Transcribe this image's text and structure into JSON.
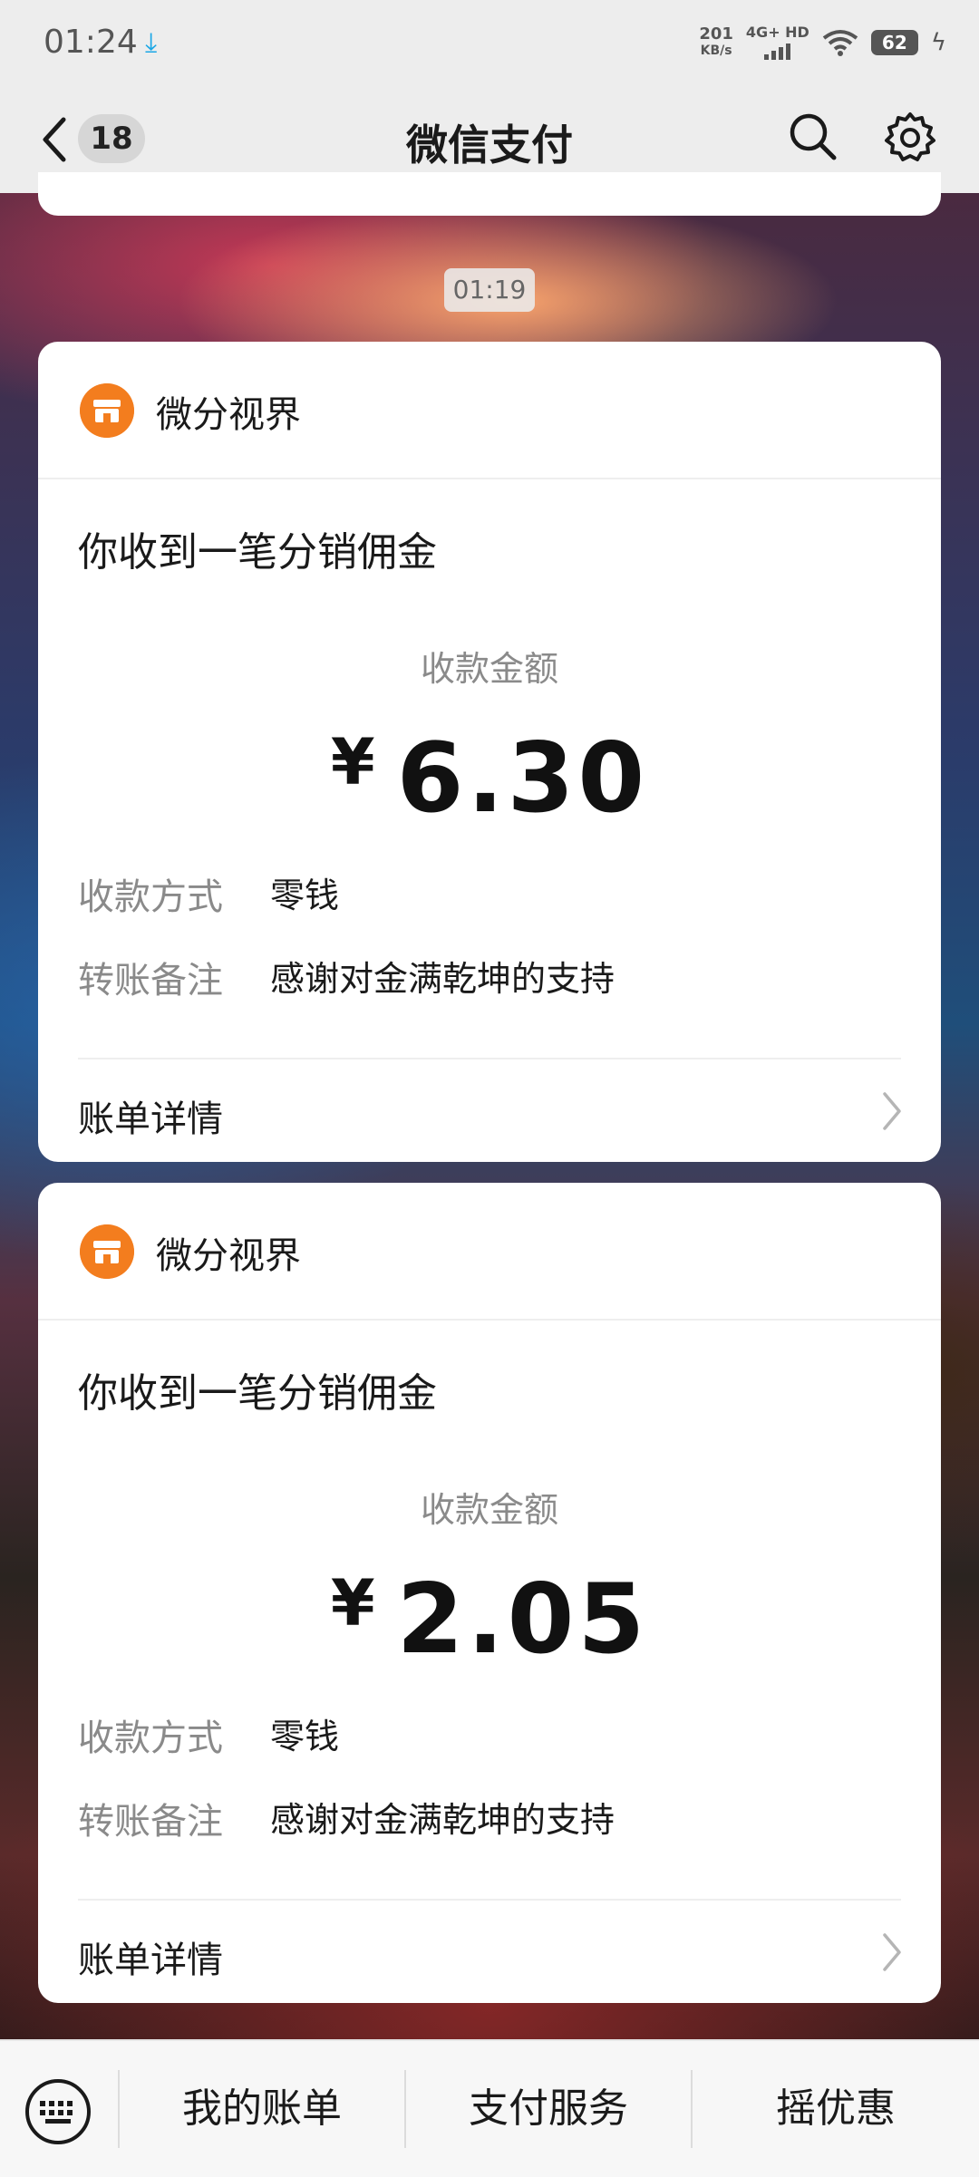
{
  "status_bar": {
    "time": "01:24",
    "download_icon": "download-arrow-icon",
    "net_speed_value": "201",
    "net_speed_unit": "KB/s",
    "network": "4G+ HD",
    "battery": "62"
  },
  "header": {
    "back_icon": "chevron-left-icon",
    "unread_count": "18",
    "title": "微信支付",
    "search_icon": "search-icon",
    "settings_icon": "gear-icon"
  },
  "time_separator": "01:19",
  "cards": [
    {
      "merchant": "微分视界",
      "title": "你收到一笔分销佣金",
      "amount_label": "收款金额",
      "currency": "¥",
      "amount": "6.30",
      "rows": [
        {
          "label": "收款方式",
          "value": "零钱"
        },
        {
          "label": "转账备注",
          "value": "感谢对金满乾坤的支持"
        }
      ],
      "details_label": "账单详情"
    },
    {
      "merchant": "微分视界",
      "title": "你收到一笔分销佣金",
      "amount_label": "收款金额",
      "currency": "¥",
      "amount": "2.05",
      "rows": [
        {
          "label": "收款方式",
          "value": "零钱"
        },
        {
          "label": "转账备注",
          "value": "感谢对金满乾坤的支持"
        }
      ],
      "details_label": "账单详情"
    }
  ],
  "bottom_bar": {
    "keyboard_icon": "keyboard-icon",
    "tabs": [
      "我的账单",
      "支付服务",
      "摇优惠"
    ]
  },
  "colors": {
    "accent_orange": "#f37d1e",
    "bar_background": "#ededed",
    "card_background": "#ffffff"
  }
}
